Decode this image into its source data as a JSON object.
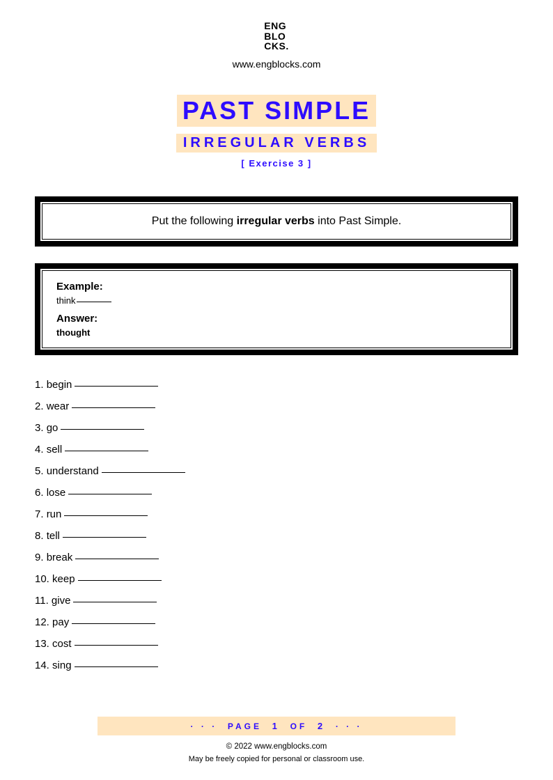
{
  "header": {
    "logo_l1": "ENG",
    "logo_l2": "BLO",
    "logo_l3": "CKS",
    "website": "www.engblocks.com"
  },
  "titles": {
    "main": "PAST SIMPLE",
    "sub": "IRREGULAR VERBS",
    "exercise": "[ Exercise 3 ]"
  },
  "instruction": {
    "prefix": "Put the following ",
    "bold": "irregular verbs",
    "suffix": " into Past Simple."
  },
  "example": {
    "label_example": "Example:",
    "example_word": "think",
    "label_answer": "Answer:",
    "answer_value": "thought"
  },
  "questions": [
    {
      "n": "1.",
      "word": "begin"
    },
    {
      "n": "2.",
      "word": "wear"
    },
    {
      "n": "3.",
      "word": "go"
    },
    {
      "n": "4.",
      "word": "sell"
    },
    {
      "n": "5.",
      "word": "understand"
    },
    {
      "n": "6.",
      "word": "lose"
    },
    {
      "n": "7.",
      "word": "run"
    },
    {
      "n": "8.",
      "word": "tell"
    },
    {
      "n": "9.",
      "word": "break"
    },
    {
      "n": "10.",
      "word": "keep"
    },
    {
      "n": "11.",
      "word": "give"
    },
    {
      "n": "12.",
      "word": "pay"
    },
    {
      "n": "13.",
      "word": "cost"
    },
    {
      "n": "14.",
      "word": "sing"
    }
  ],
  "footer": {
    "pager_dots_left": "· · ·",
    "pager_word_page": "PAGE",
    "pager_current": "1",
    "pager_word_of": "OF",
    "pager_total": "2",
    "pager_dots_right": "· · ·",
    "copyright": "© 2022 www.engblocks.com",
    "license": "May be freely copied for personal or classroom use."
  }
}
